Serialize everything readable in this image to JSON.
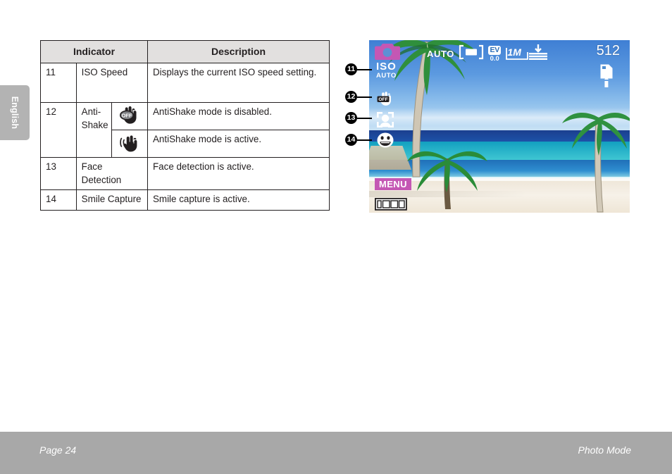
{
  "page": {
    "language_tab": "English",
    "footer_left": "Page 24",
    "footer_right": "Photo Mode"
  },
  "table": {
    "headers": {
      "indicator": "Indicator",
      "description": "Description"
    },
    "rows": [
      {
        "num": "11",
        "name": "ISO Speed",
        "icon": "",
        "desc": "Displays the current ISO speed setting."
      },
      {
        "num": "12",
        "name": "Anti-Shake",
        "icon": "hand-off-icon",
        "desc": "AntiShake mode is disabled."
      },
      {
        "num": "",
        "name": "",
        "icon": "hand-shake-icon",
        "desc": "AntiShake mode is active."
      },
      {
        "num": "13",
        "name": "Face Detection",
        "icon": "",
        "desc": "Face detection is active."
      },
      {
        "num": "14",
        "name": "Smile Capture",
        "icon": "",
        "desc": "Smile capture is active."
      }
    ]
  },
  "lcd": {
    "mode_icon": "camera-icon",
    "iso_label": "ISO",
    "iso_value": "AUTO",
    "antishake_state": "OFF",
    "face_detection_icon": "face-detection-icon",
    "smile_capture_icon": "smile-capture-icon",
    "top_bar": {
      "white_balance": "AUTO",
      "metering_icon": "metering-icon",
      "ev_label": "EV",
      "ev_value": "0.0",
      "resolution": "1M",
      "quality_icon": "quality-icon"
    },
    "shots_remaining": "512",
    "storage_icon": "memory-card-icon",
    "menu_label": "MENU",
    "battery_icon": "battery-icon"
  },
  "callouts": [
    {
      "num": "11"
    },
    {
      "num": "12"
    },
    {
      "num": "13"
    },
    {
      "num": "14"
    }
  ],
  "colors": {
    "magenta": "#c457b4",
    "header_bg": "#e2e0df",
    "footer_bg": "#a8a8a8",
    "tab_bg": "#b3b3b3"
  }
}
